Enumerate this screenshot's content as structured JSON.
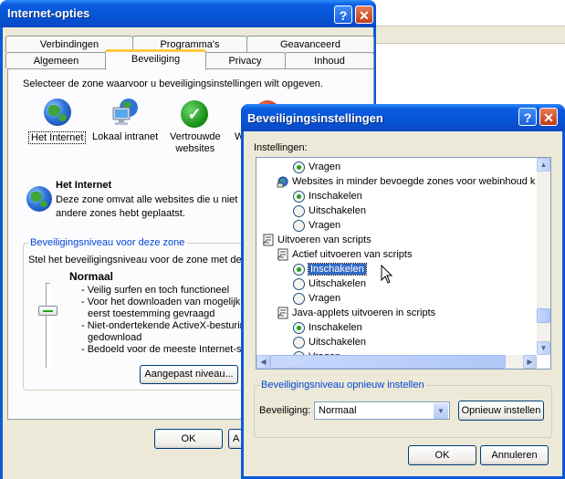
{
  "main_window": {
    "title": "Internet-opties",
    "help_glyph": "?",
    "close_glyph": "✕",
    "tabs_row1": [
      "Verbindingen",
      "Programma's",
      "Geavanceerd"
    ],
    "tabs_row2": [
      "Algemeen",
      "Beveiliging",
      "Privacy",
      "Inhoud"
    ],
    "active_tab": "Beveiliging",
    "zone_prompt": "Selecteer de zone waarvoor u beveiligingsinstellingen wilt opgeven.",
    "zones": [
      {
        "label": "Het Internet",
        "icon": "globe-icon"
      },
      {
        "label": "Lokaal intranet",
        "icon": "computer-icon"
      },
      {
        "label": "Vertrouwde\nwebsites",
        "icon": "check-icon"
      },
      {
        "label": "W",
        "icon": "restricted-icon"
      }
    ],
    "zone_title": "Het Internet",
    "zone_desc_1": "Deze zone omvat alle websites die u niet in",
    "zone_desc_2": "andere zones hebt geplaatst.",
    "level_group_label": "Beveiligingsniveau voor deze zone",
    "level_prompt": "Stel het beveiligingsniveau voor de zone met de s",
    "level_name": "Normaal",
    "level_items": [
      "- Veilig surfen en toch functioneel",
      "- Voor het downloaden van mogelijk o",
      "eerst toestemming gevraagd",
      "- Niet-ondertekende ActiveX-besturin",
      "gedownload",
      "- Bedoeld voor de meeste Internet-site"
    ],
    "custom_level_button": "Aangepast niveau...",
    "ok_button": "OK",
    "cancel_button_partial": "A"
  },
  "security_dialog": {
    "title": "Beveiligingsinstellingen",
    "help_glyph": "?",
    "close_glyph": "✕",
    "settings_label": "Instellingen:",
    "list": [
      {
        "type": "radio",
        "label": "Vragen",
        "checked": true,
        "indent": 1
      },
      {
        "type": "header",
        "label": "Websites in minder bevoegde zones voor webinhoud k",
        "icon": "setting-icon",
        "indent": 1
      },
      {
        "type": "radio",
        "label": "Inschakelen",
        "checked": true,
        "indent": 1
      },
      {
        "type": "radio",
        "label": "Uitschakelen",
        "checked": false,
        "indent": 1
      },
      {
        "type": "radio",
        "label": "Vragen",
        "checked": false,
        "indent": 1
      },
      {
        "type": "header",
        "label": "Uitvoeren van scripts",
        "icon": "script-icon",
        "indent": 0
      },
      {
        "type": "header",
        "label": "Actief uitvoeren van scripts",
        "icon": "script-icon",
        "indent": 1
      },
      {
        "type": "radio",
        "label": "Inschakelen",
        "checked": true,
        "indent": 1,
        "selected": true
      },
      {
        "type": "radio",
        "label": "Uitschakelen",
        "checked": false,
        "indent": 1
      },
      {
        "type": "radio",
        "label": "Vragen",
        "checked": false,
        "indent": 1
      },
      {
        "type": "header",
        "label": "Java-applets uitvoeren in scripts",
        "icon": "script-icon",
        "indent": 1
      },
      {
        "type": "radio",
        "label": "Inschakelen",
        "checked": true,
        "indent": 1
      },
      {
        "type": "radio",
        "label": "Uitschakelen",
        "checked": false,
        "indent": 1
      },
      {
        "type": "radio",
        "label": "Vragen",
        "checked": false,
        "indent": 1
      }
    ],
    "reset_group_label": "Beveiligingsniveau opnieuw instellen",
    "reset_label": "Beveiliging:",
    "reset_value": "Normaal",
    "reset_button": "Opnieuw instellen",
    "ok_button": "OK",
    "cancel_button": "Annuleren"
  }
}
